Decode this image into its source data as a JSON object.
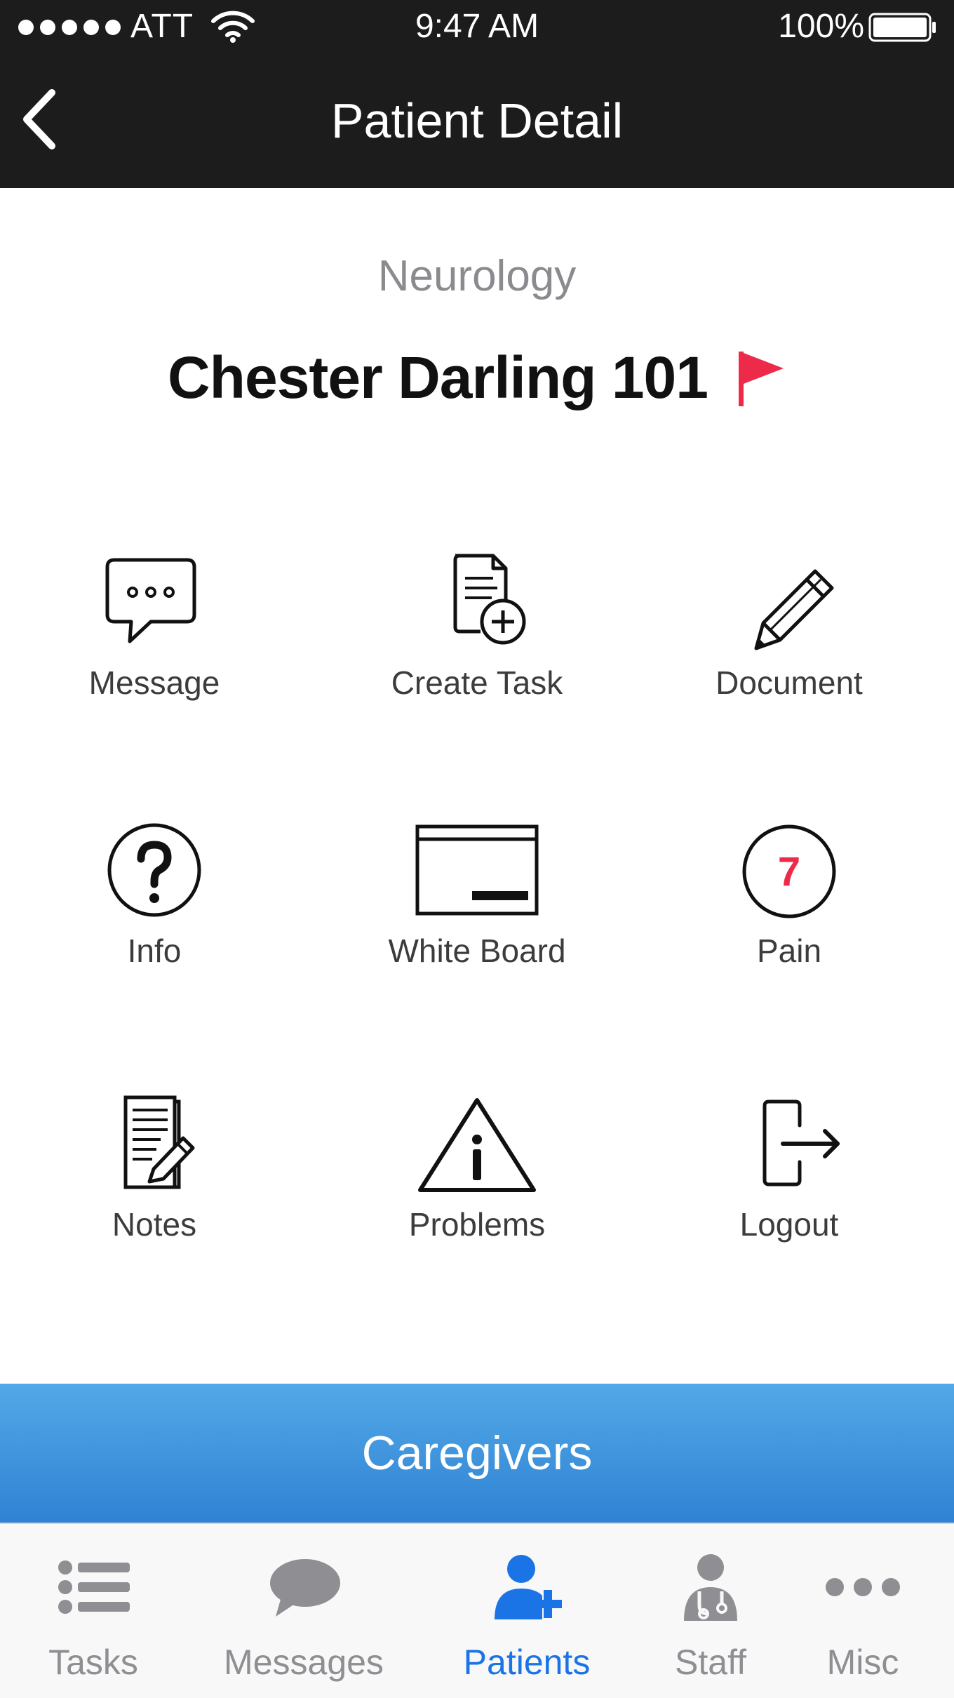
{
  "status_bar": {
    "carrier": "ATT",
    "time": "9:47 AM",
    "battery": "100%"
  },
  "nav": {
    "title": "Patient Detail"
  },
  "patient": {
    "department": "Neurology",
    "name": "Chester Darling 101",
    "flag_color": "#ee2a4a"
  },
  "actions": [
    {
      "label": "Message",
      "icon": "message-bubble-icon"
    },
    {
      "label": "Create Task",
      "icon": "create-task-icon"
    },
    {
      "label": "Document",
      "icon": "pencil-icon"
    },
    {
      "label": "Info",
      "icon": "question-circle-icon"
    },
    {
      "label": "White Board",
      "icon": "whiteboard-icon"
    },
    {
      "label": "Pain",
      "icon": "pain-score-icon",
      "pain_score": "7"
    },
    {
      "label": "Notes",
      "icon": "notes-icon"
    },
    {
      "label": "Problems",
      "icon": "warning-triangle-icon"
    },
    {
      "label": "Logout",
      "icon": "logout-icon"
    }
  ],
  "caregivers": {
    "label": "Caregivers",
    "colors": [
      "#52a9e6",
      "#2f82d4"
    ]
  },
  "tabs": [
    {
      "label": "Tasks",
      "icon": "list-icon",
      "active": false
    },
    {
      "label": "Messages",
      "icon": "chat-bubble-icon",
      "active": false
    },
    {
      "label": "Patients",
      "icon": "add-patient-icon",
      "active": true
    },
    {
      "label": "Staff",
      "icon": "doctor-icon",
      "active": false
    },
    {
      "label": "Misc",
      "icon": "more-dots-icon",
      "active": false
    }
  ],
  "colors": {
    "accent": "#1a74e6",
    "inactive": "#8e8e93",
    "header": "#1c1c1c",
    "alert": "#ee2a4a"
  }
}
